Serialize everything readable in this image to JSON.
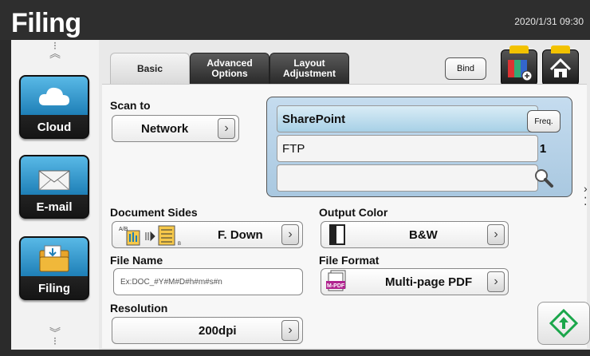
{
  "app": {
    "title": "Filing",
    "datetime": "2020/1/31 09:30"
  },
  "sidebar": {
    "items": [
      {
        "label": "Cloud",
        "icon": "cloud-icon"
      },
      {
        "label": "E-mail",
        "icon": "envelope-icon"
      },
      {
        "label": "Filing",
        "icon": "folder-icon"
      }
    ]
  },
  "tabs": [
    {
      "label": "Basic",
      "active": true
    },
    {
      "label": "Advanced Options",
      "active": false
    },
    {
      "label": "Layout Adjustment",
      "active": false
    }
  ],
  "toolbar": {
    "bind_label": "Bind"
  },
  "scan_to": {
    "label": "Scan to",
    "value": "Network",
    "destinations": [
      "SharePoint",
      "FTP",
      ""
    ],
    "freq_label": "Freq.",
    "count": "1"
  },
  "document_sides": {
    "label": "Document Sides",
    "value": "F. Down"
  },
  "output_color": {
    "label": "Output Color",
    "value": "B&W"
  },
  "file_name": {
    "label": "File Name",
    "value": "Ex:DOC_#Y#M#D#h#m#s#n"
  },
  "file_format": {
    "label": "File Format",
    "value": "Multi-page PDF",
    "icon_text": "M-PDF"
  },
  "resolution": {
    "label": "Resolution",
    "value": "200dpi"
  },
  "colors": {
    "accent": "#1e7fb7",
    "start_green": "#1aa64a",
    "tab_dark": "#2a2a2a"
  }
}
